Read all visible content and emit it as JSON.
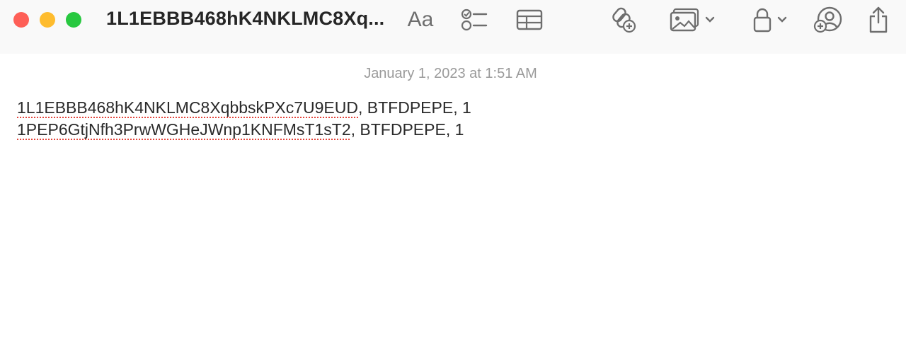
{
  "window": {
    "title": "1L1EBBB468hK4NKLMC8Xq..."
  },
  "toolbar": {
    "format_label": "Aa",
    "icons": [
      "checklist-icon",
      "table-icon",
      "link-add-icon",
      "media-icon",
      "lock-icon",
      "collaborate-icon",
      "share-icon"
    ]
  },
  "note": {
    "timestamp": "January 1, 2023 at 1:51 AM",
    "lines": [
      {
        "address": "1L1EBBB468hK4NKLMC8XqbbskPXc7U9EUD",
        "rest": ", BTFDPEPE, 1"
      },
      {
        "address": "1PEP6GtjNfh3PrwWGHeJWnp1KNFMsT1sT2",
        "rest": ", BTFDPEPE, 1"
      }
    ]
  },
  "colors": {
    "close": "#fe5f57",
    "minimize": "#febc2e",
    "maximize": "#28c840",
    "spellcheck": "#e5453c"
  }
}
